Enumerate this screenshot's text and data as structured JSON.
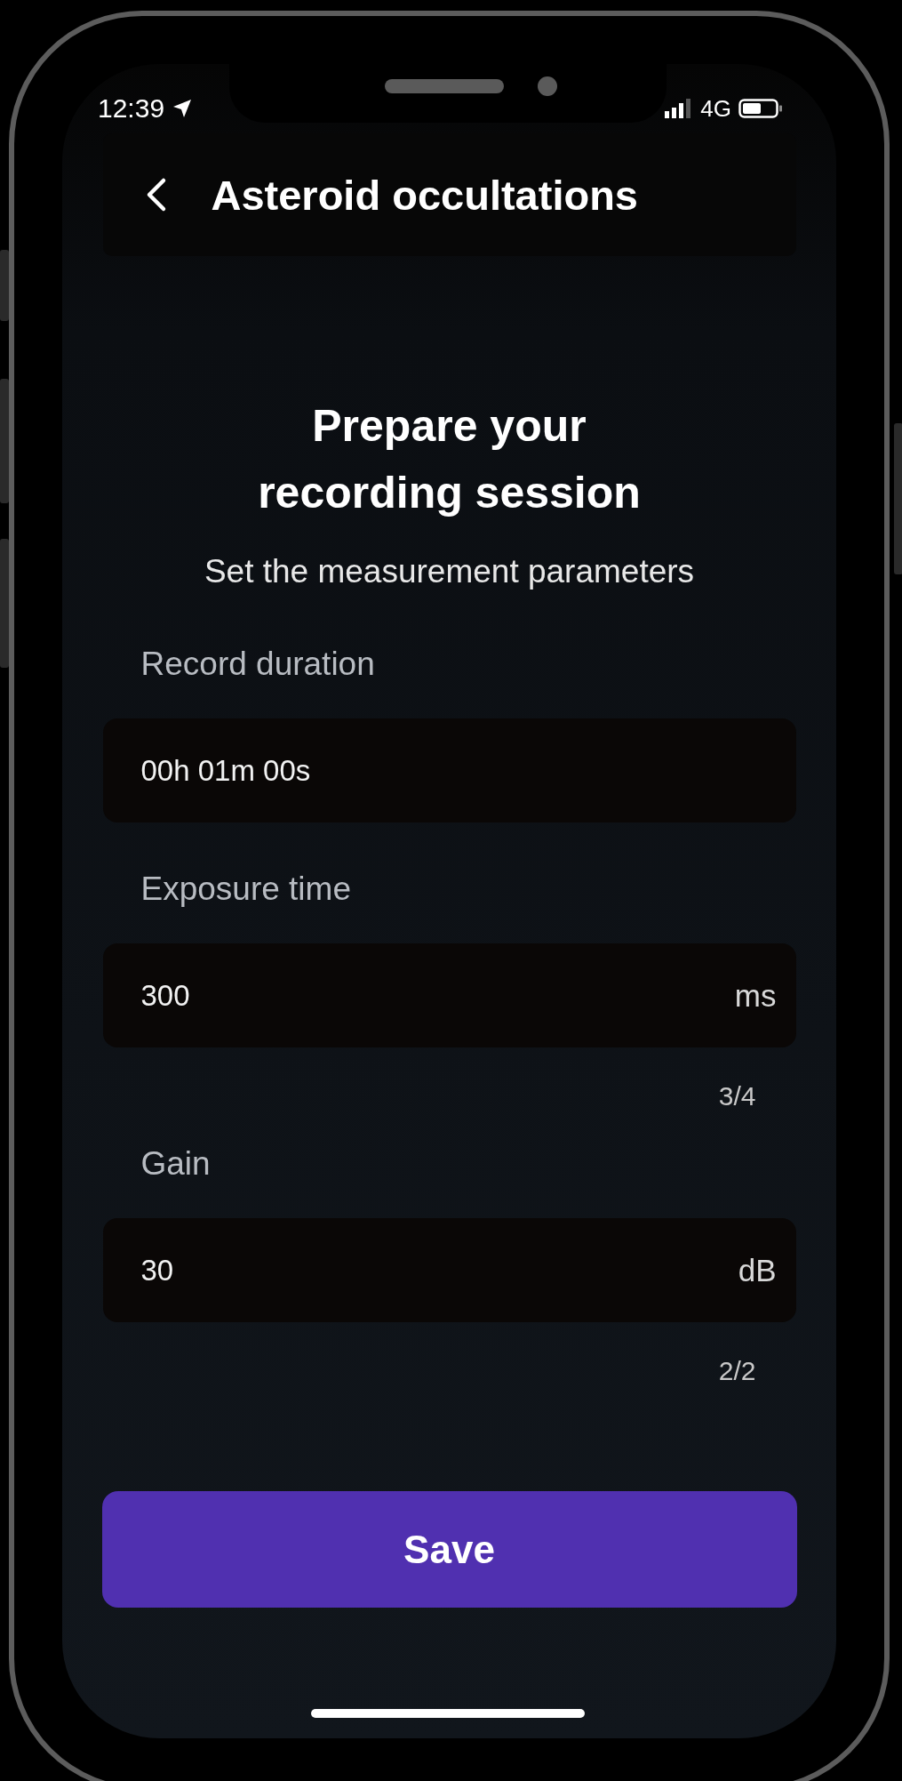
{
  "status_bar": {
    "time": "12:39",
    "network": "4G"
  },
  "header": {
    "title": "Asteroid occultations"
  },
  "heading": "Prepare your recording session",
  "subtitle": "Set the measurement parameters",
  "fields": [
    {
      "label": "Record duration",
      "value": "00h 01m 00s"
    },
    {
      "label": "Exposure time",
      "value": "300",
      "unit": "ms",
      "counter": "3/4"
    },
    {
      "label": "Gain",
      "value": "30",
      "unit": "dB",
      "counter": "2/2"
    }
  ],
  "button": {
    "label": "Save"
  }
}
